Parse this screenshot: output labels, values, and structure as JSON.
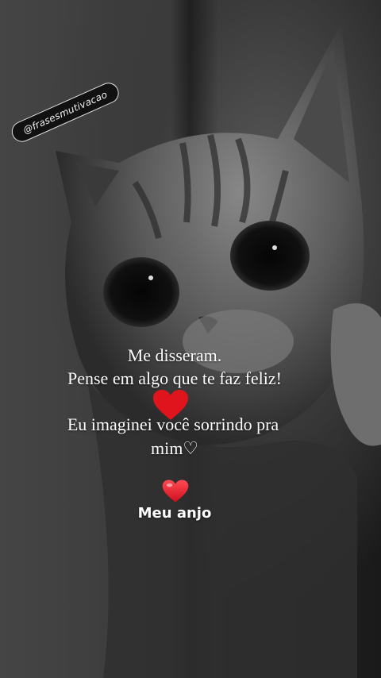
{
  "handle": "@frasesmutivacao",
  "message": {
    "line1": "Me disseram.",
    "line2": "Pense em algo que te faz feliz!",
    "line3": "Eu imaginei você sorrindo pra",
    "line4": "mim♡"
  },
  "caption": "Meu anjo",
  "icons": [
    "red-heart-icon",
    "red-heart-emoji-icon"
  ],
  "colors": {
    "heart": "#e0141c",
    "text": "#ffffff"
  }
}
